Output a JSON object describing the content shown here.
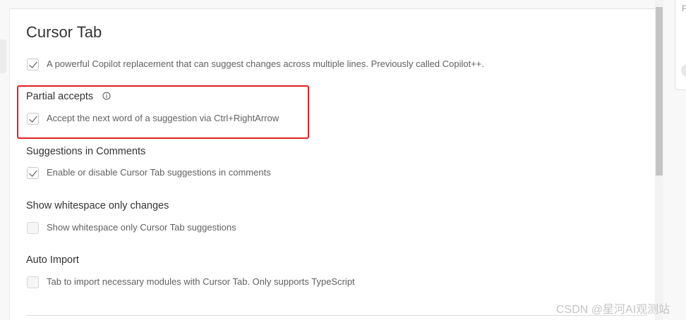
{
  "section": {
    "title": "Cursor Tab",
    "main_option": {
      "label": "A powerful Copilot replacement that can suggest changes across multiple lines. Previously called Copilot++.",
      "checked": true
    }
  },
  "settings": [
    {
      "heading": "Partial accepts",
      "has_info_icon": true,
      "label": "Accept the next word of a suggestion via Ctrl+RightArrow",
      "checked": true,
      "highlighted": true
    },
    {
      "heading": "Suggestions in Comments",
      "label": "Enable or disable Cursor Tab suggestions in comments",
      "checked": true
    },
    {
      "heading": "Show whitespace only changes",
      "label": "Show whitespace only Cursor Tab suggestions",
      "checked": false
    },
    {
      "heading": "Auto Import",
      "label": "Tab to import necessary modules with Cursor Tab. Only supports TypeScript",
      "checked": false
    }
  ],
  "right_pane": {
    "partial_text": "F"
  },
  "watermark": "CSDN @星河AI观测站",
  "colors": {
    "highlight_border": "#e0201e",
    "scrollbar_thumb": "#c4c4c4"
  },
  "icons": {
    "check": "checkmark-icon",
    "info": "info-icon"
  }
}
